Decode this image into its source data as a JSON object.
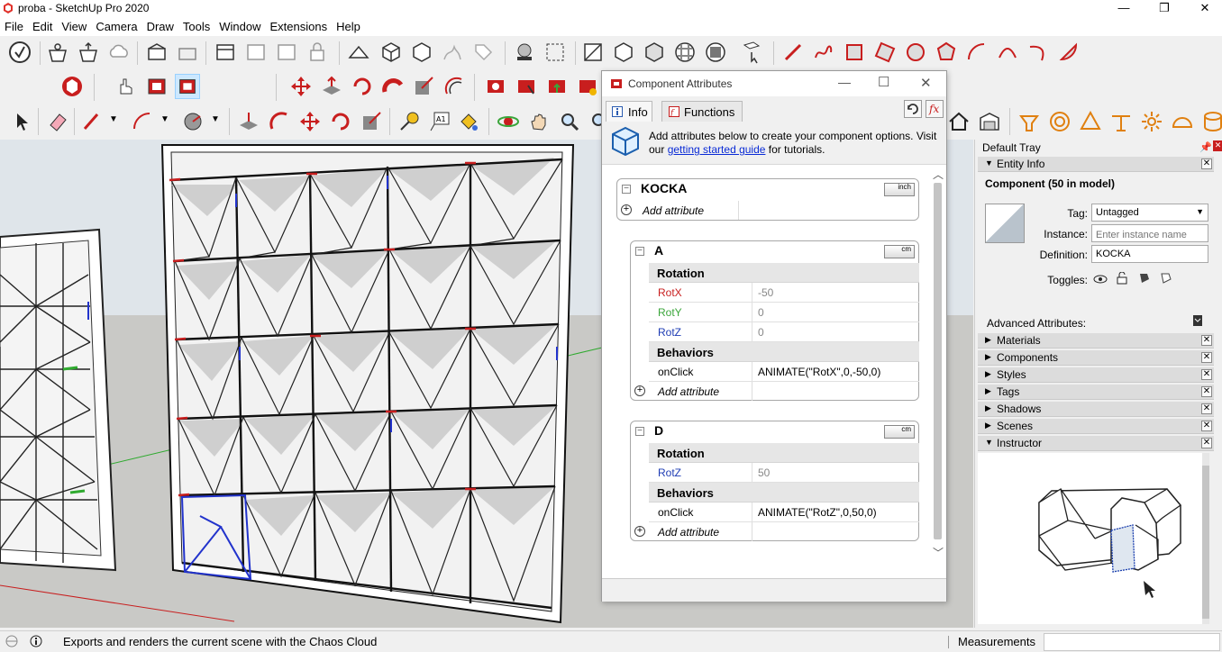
{
  "window": {
    "title": "proba - SketchUp Pro 2020",
    "minimize": "—",
    "maximize": "❐",
    "close": "✕"
  },
  "menu": [
    "File",
    "Edit",
    "View",
    "Camera",
    "Draw",
    "Tools",
    "Window",
    "Extensions",
    "Help"
  ],
  "dialog": {
    "title": "Component Attributes",
    "tabs": {
      "info": "Info",
      "functions": "Functions"
    },
    "help_text_before": "Add attributes below to create your component options. Visit our ",
    "help_link": "getting started guide",
    "help_text_after": " for tutorials.",
    "root": {
      "name": "KOCKA",
      "unit": "inch",
      "add_attribute": "Add attribute"
    },
    "components": [
      {
        "name": "A",
        "unit": "cm",
        "rotation_label": "Rotation",
        "rows": [
          {
            "key": "RotX",
            "value": "-50",
            "color": "#c81e1e"
          },
          {
            "key": "RotY",
            "value": "0",
            "color": "#3aa53a"
          },
          {
            "key": "RotZ",
            "value": "0",
            "color": "#1e3cb4"
          }
        ],
        "behaviors_label": "Behaviors",
        "behavior": {
          "key": "onClick",
          "value": "ANIMATE(\"RotX\",0,-50,0)"
        },
        "add_attribute": "Add attribute"
      },
      {
        "name": "D",
        "unit": "cm",
        "rotation_label": "Rotation",
        "rows": [
          {
            "key": "RotZ",
            "value": "50",
            "color": "#1e3cb4"
          }
        ],
        "behaviors_label": "Behaviors",
        "behavior": {
          "key": "onClick",
          "value": "ANIMATE(\"RotZ\",0,50,0)"
        },
        "add_attribute": "Add attribute"
      }
    ]
  },
  "tray": {
    "title": "Default Tray",
    "entity_info": {
      "header": "Entity Info",
      "summary": "Component (50 in model)",
      "tag_label": "Tag:",
      "tag_value": "Untagged",
      "instance_label": "Instance:",
      "instance_placeholder": "Enter instance name",
      "definition_label": "Definition:",
      "definition_value": "KOCKA",
      "toggles_label": "Toggles:"
    },
    "advanced_label": "Advanced Attributes:",
    "panels": [
      "Materials",
      "Components",
      "Styles",
      "Tags",
      "Shadows",
      "Scenes"
    ],
    "instructor": "Instructor"
  },
  "status": {
    "message": "Exports and renders the current scene with the Chaos Cloud",
    "measurements_label": "Measurements"
  },
  "colors": {
    "accent_red": "#c81e1e",
    "link_blue": "#0a2bd6"
  }
}
